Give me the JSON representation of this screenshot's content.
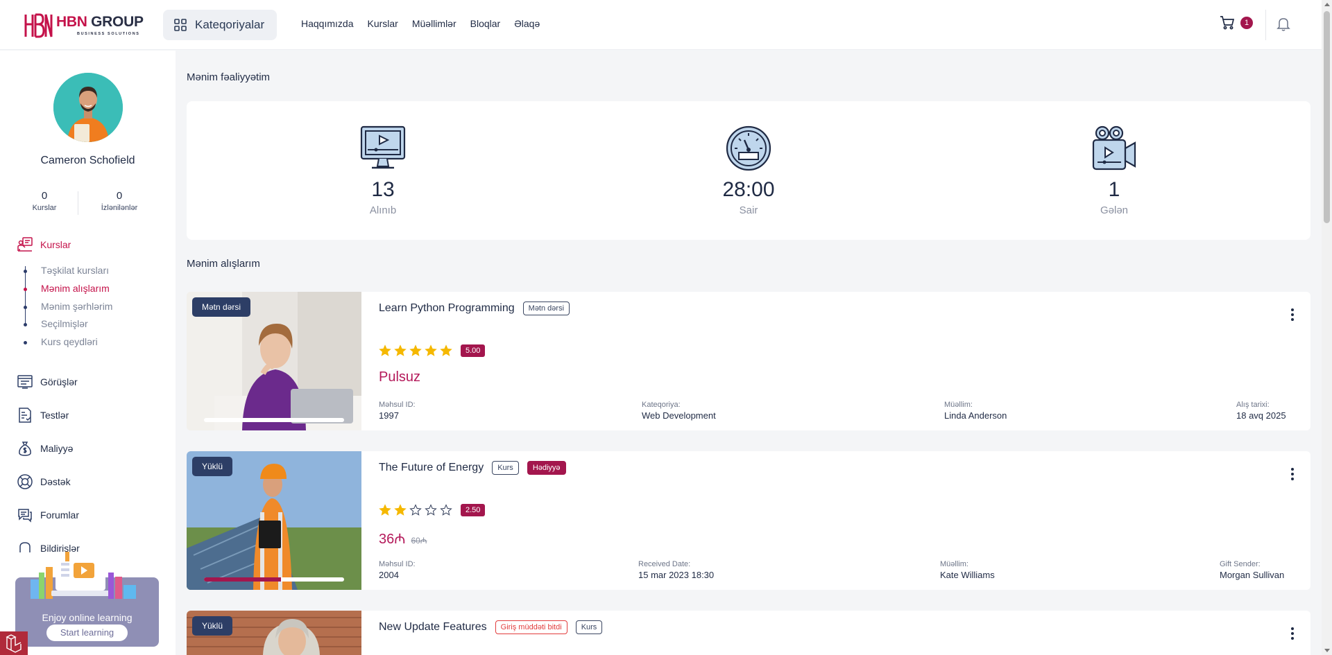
{
  "header": {
    "logo_prefix": "HBN",
    "logo_suffix": " GROUP",
    "logo_sub": "BUSINESS SOLUTIONS",
    "categories_label": "Kateqoriyalar",
    "nav": [
      "Haqqımızda",
      "Kurslar",
      "Müəllimlər",
      "Bloqlar",
      "Əlaqə"
    ],
    "cart_count": "1"
  },
  "sidebar": {
    "user_name": "Cameron Schofield",
    "stats": [
      {
        "value": "0",
        "label": "Kurslar"
      },
      {
        "value": "0",
        "label": "İzlənilənlər"
      }
    ],
    "courses_label": "Kurslar",
    "submenu": [
      "Təşkilat kursları",
      "Mənim alışlarım",
      "Mənim şərhlərim",
      "Seçilmişlər",
      "Kurs qeydləri"
    ],
    "menu": [
      "Görüşlər",
      "Testlər",
      "Maliyyə",
      "Dəstək",
      "Forumlar",
      "Bildirişlər"
    ],
    "promo_title": "Enjoy online learning",
    "promo_button": "Start learning"
  },
  "main": {
    "activity_title": "Mənim fəaliyyətim",
    "activity": [
      {
        "value": "13",
        "label": "Alınıb",
        "icon": "monitor-video-icon"
      },
      {
        "value": "28:00",
        "label": "Sair",
        "icon": "speedometer-icon"
      },
      {
        "value": "1",
        "label": "Gələn",
        "icon": "video-camera-icon"
      }
    ],
    "purchases_title": "Mənim alışlarım",
    "courses": [
      {
        "thumb_tag": "Mətn dərsi",
        "title": "Learn Python Programming",
        "tag1": "Mətn dərsi",
        "rating": "5.00",
        "stars": 5,
        "price": "Pulsuz",
        "old_price": "",
        "progress": 1.0,
        "meta": [
          {
            "k": "Məhsul ID:",
            "v": "1997"
          },
          {
            "k": "Kateqoriya:",
            "v": "Web Development"
          },
          {
            "k": "Müəllim:",
            "v": "Linda Anderson"
          },
          {
            "k": "Alış tarixi:",
            "v": "18 avq 2025"
          }
        ]
      },
      {
        "thumb_tag": "Yüklü",
        "title": "The Future of Energy",
        "tag1": "Kurs",
        "tag2": "Hədiyyə",
        "rating": "2.50",
        "stars": 2,
        "price": "36₼",
        "old_price": "60₼",
        "progress": 0.55,
        "meta": [
          {
            "k": "Məhsul ID:",
            "v": "2004"
          },
          {
            "k": "Received Date:",
            "v": "15 mar 2023 18:30"
          },
          {
            "k": "Müəllim:",
            "v": "Kate Williams"
          },
          {
            "k": "Gift Sender:",
            "v": "Morgan Sullivan"
          }
        ]
      },
      {
        "thumb_tag": "Yüklü",
        "title": "New Update Features",
        "tag1": "Giriş müddəti bitdi",
        "tag2": "Kurs"
      }
    ]
  },
  "colors": {
    "brand": "#c4124a",
    "accent_badge": "#a3164d",
    "navy": "#2d3e66"
  }
}
